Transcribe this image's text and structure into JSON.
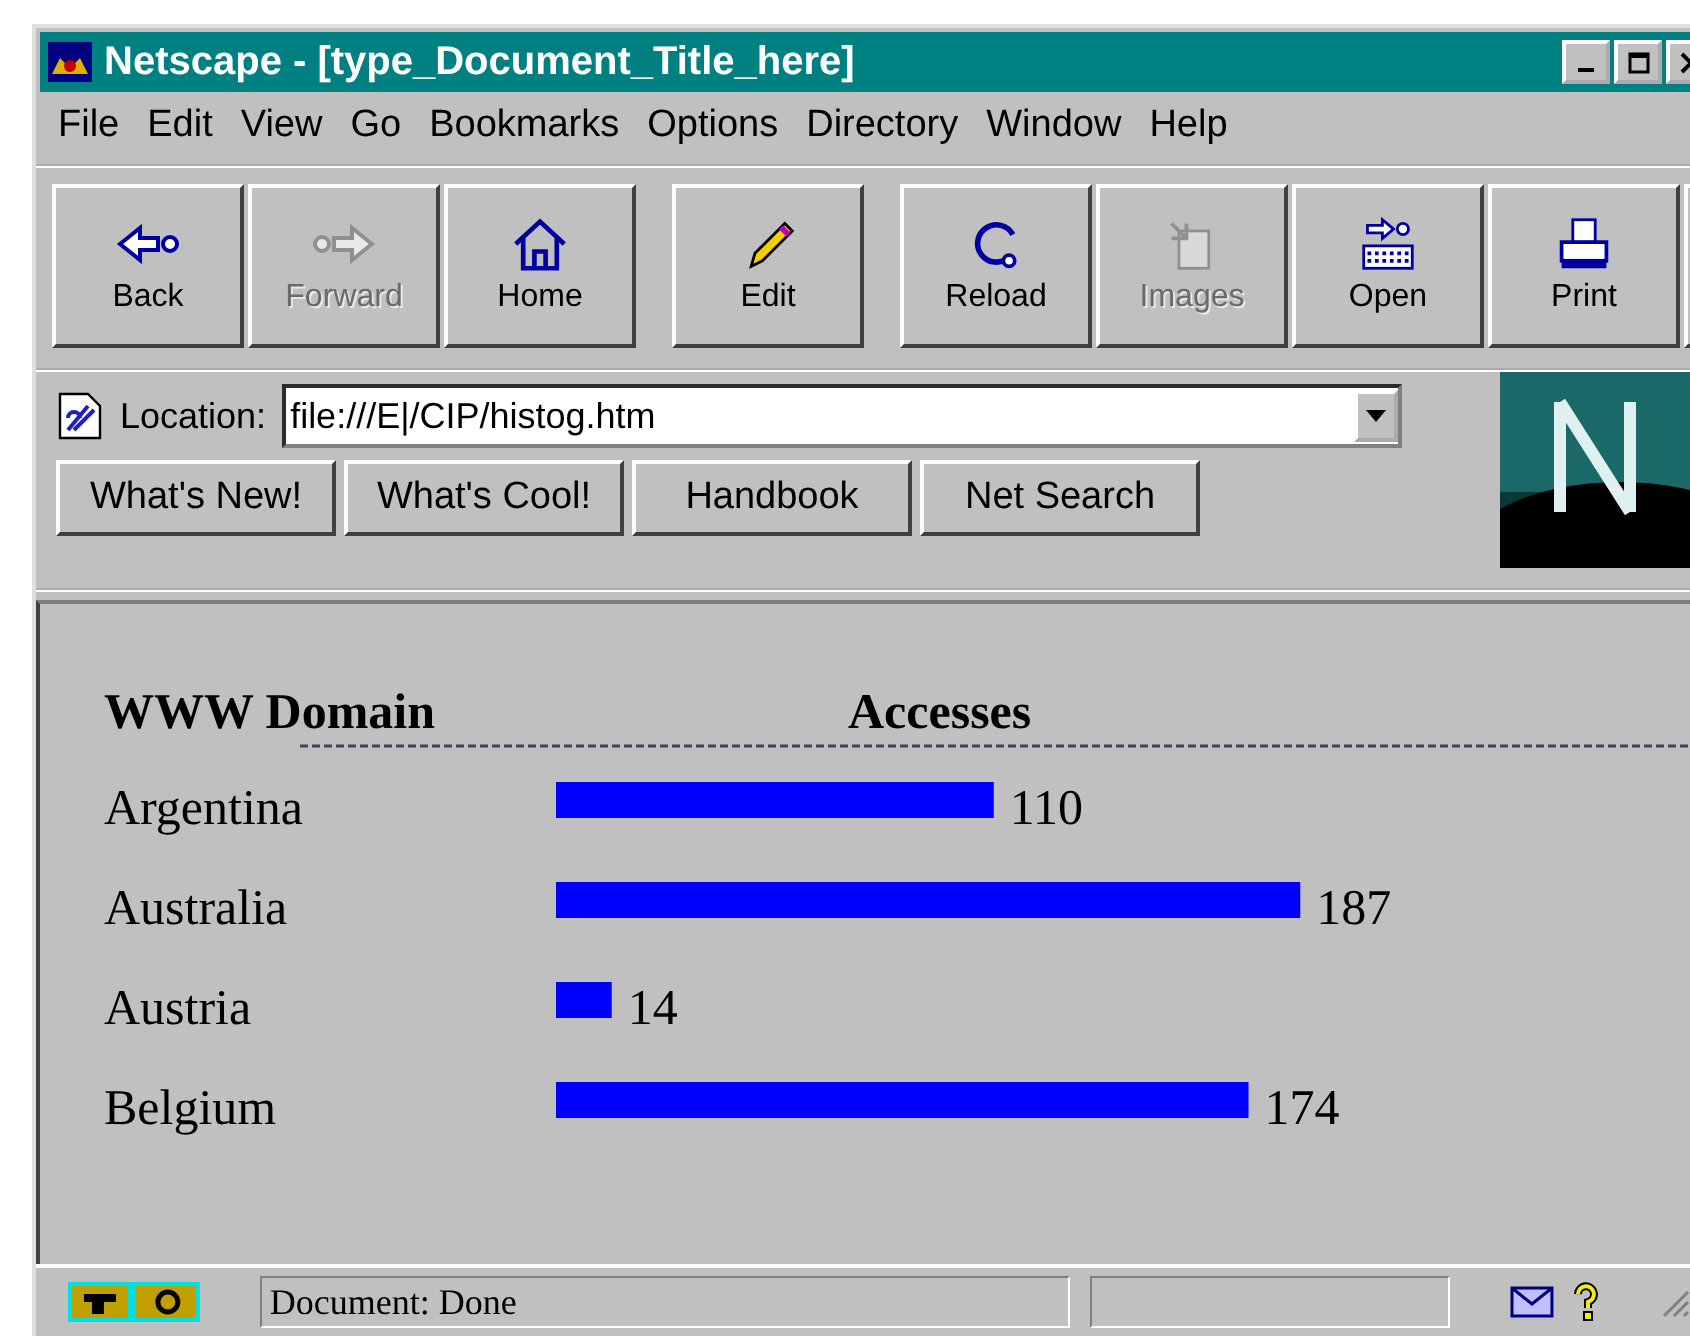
{
  "window": {
    "title": "Netscape - [type_Document_Title_here]"
  },
  "menu": [
    "File",
    "Edit",
    "View",
    "Go",
    "Bookmarks",
    "Options",
    "Directory",
    "Window",
    "Help"
  ],
  "toolbar": [
    {
      "kind": "back",
      "label": "Back",
      "disabled": false
    },
    {
      "kind": "forward",
      "label": "Forward",
      "disabled": true
    },
    {
      "kind": "home",
      "label": "Home",
      "disabled": false
    },
    {
      "kind": "edit",
      "label": "Edit",
      "disabled": false
    },
    {
      "kind": "reload",
      "label": "Reload",
      "disabled": false
    },
    {
      "kind": "images",
      "label": "Images",
      "disabled": true
    },
    {
      "kind": "open",
      "label": "Open",
      "disabled": false
    },
    {
      "kind": "print",
      "label": "Print",
      "disabled": false
    }
  ],
  "location": {
    "label": "Location:",
    "value": "file:///E|/CIP/histog.htm"
  },
  "directory_buttons": [
    "What's New!",
    "What's Cool!",
    "Handbook",
    "Net Search"
  ],
  "content": {
    "headers": [
      "WWW Domain",
      "Accesses"
    ],
    "chart_data": {
      "type": "bar",
      "orientation": "horizontal",
      "categories": [
        "Argentina",
        "Australia",
        "Austria",
        "Belgium"
      ],
      "values": [
        110,
        187,
        14,
        174
      ],
      "data_labels": true
    }
  },
  "status_bar": {
    "text": "Document: Done"
  }
}
